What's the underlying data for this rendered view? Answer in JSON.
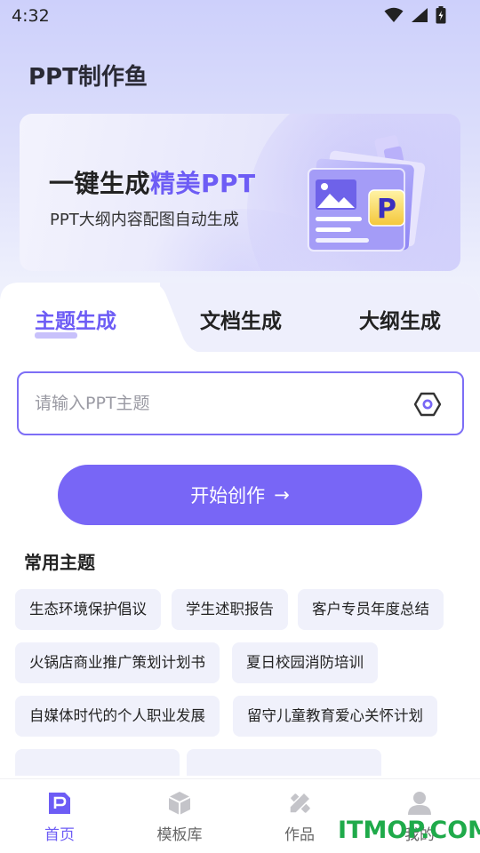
{
  "status_bar": {
    "time": "4:32"
  },
  "app": {
    "title": "PPT制作鱼"
  },
  "banner": {
    "headline_prefix": "一键生成",
    "headline_accent": "精美PPT",
    "subtitle": "PPT大纲内容配图自动生成",
    "art_letter": "P"
  },
  "tabs": [
    {
      "label": "主题生成",
      "active": true
    },
    {
      "label": "文档生成",
      "active": false
    },
    {
      "label": "大纲生成",
      "active": false
    }
  ],
  "topic_input": {
    "placeholder": "请输入PPT主题",
    "value": ""
  },
  "start_button": {
    "label": "开始创作",
    "arrow": "→"
  },
  "common_topics": {
    "title": "常用主题",
    "items": [
      "生态环境保护倡议",
      "学生述职报告",
      "客户专员年度总结",
      "火锅店商业推广策划计划书",
      "夏日校园消防培训",
      "自媒体时代的个人职业发展",
      "留守儿童教育爱心关怀计划"
    ]
  },
  "bottom_nav": [
    {
      "label": "首页",
      "icon": "home-ppt-icon",
      "active": true
    },
    {
      "label": "模板库",
      "icon": "cube-icon",
      "active": false
    },
    {
      "label": "作品",
      "icon": "pen-ruler-icon",
      "active": false
    },
    {
      "label": "我的",
      "icon": "person-icon",
      "active": false
    }
  ],
  "watermark": "ITMOP.COM",
  "colors": {
    "accent": "#6d5cf5",
    "button": "#7866f6",
    "chip_bg": "#f0f1fb",
    "watermark": "#1faa4a"
  }
}
